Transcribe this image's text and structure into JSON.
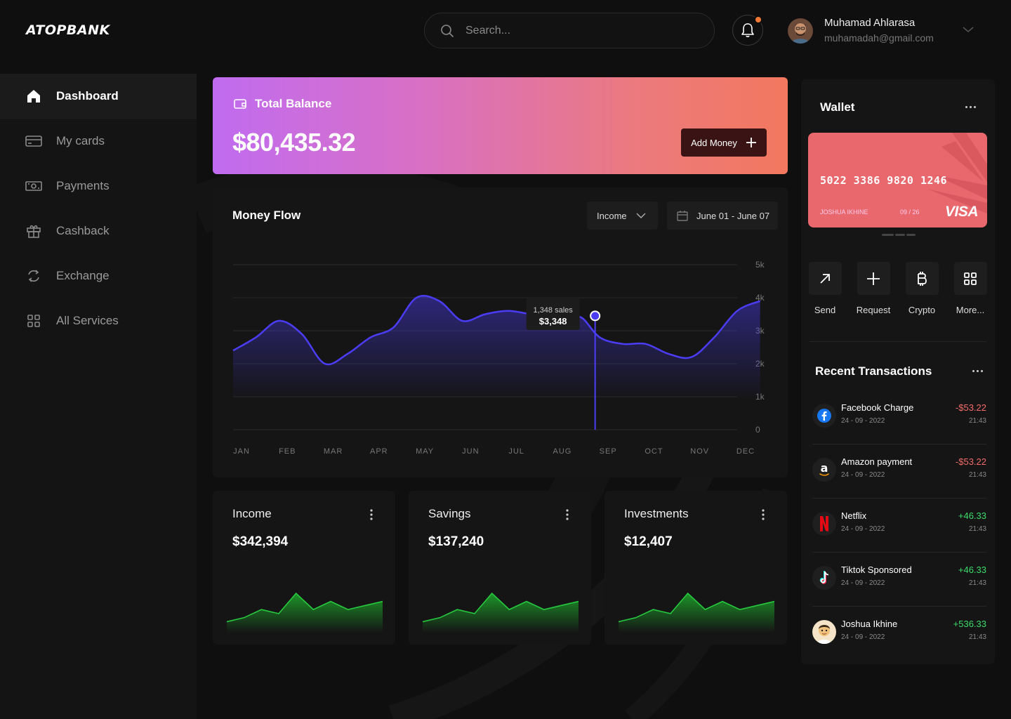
{
  "app": {
    "logo": "ATOPBANK"
  },
  "header": {
    "search_placeholder": "Search...",
    "user_name": "Muhamad Ahlarasa",
    "user_email": "muhamadah@gmail.com",
    "notification_dot_color": "#f07a34"
  },
  "sidebar": {
    "items": [
      {
        "label": "Dashboard",
        "icon": "home-icon"
      },
      {
        "label": "My cards",
        "icon": "card-icon"
      },
      {
        "label": "Payments",
        "icon": "banknote-icon"
      },
      {
        "label": "Cashback",
        "icon": "gift-icon"
      },
      {
        "label": "Exchange",
        "icon": "exchange-icon"
      },
      {
        "label": "All Services",
        "icon": "grid-icon"
      }
    ]
  },
  "balance": {
    "label": "Total Balance",
    "amount": "$80,435.32",
    "add_money_label": "Add Money"
  },
  "money_flow": {
    "title": "Money Flow",
    "filter_selected": "Income",
    "date_range": "June 01 - June 07",
    "tooltip_sales": "1,348 sales",
    "tooltip_value": "$3,348"
  },
  "chart_data": {
    "type": "line",
    "categories": [
      "JAN",
      "FEB",
      "MAR",
      "APR",
      "MAY",
      "JUN",
      "JUL",
      "AUG",
      "SEP",
      "OCT",
      "NOV",
      "DEC"
    ],
    "x": [
      0,
      0.5,
      1,
      1.5,
      2,
      2.5,
      3,
      3.5,
      4,
      4.5,
      5,
      5.5,
      6,
      6.5,
      7,
      7.3,
      7.6,
      8,
      8.5,
      9,
      9.5,
      10,
      10.5,
      11,
      11.5
    ],
    "y": [
      2.4,
      2.8,
      3.3,
      2.9,
      2.0,
      2.3,
      2.8,
      3.1,
      4.0,
      3.9,
      3.3,
      3.5,
      3.6,
      3.5,
      3.4,
      3.3,
      3.4,
      2.8,
      2.6,
      2.6,
      2.3,
      2.2,
      2.8,
      3.6,
      3.9
    ],
    "yticks": [
      "0",
      "1k",
      "2k",
      "3k",
      "4k",
      "5k"
    ],
    "ylim": [
      0,
      5
    ],
    "highlight_x": 7.9,
    "highlight_y": 3.45,
    "line_color": "#4b3cf5",
    "grid": true
  },
  "stats": [
    {
      "title": "Income",
      "value": "$342,394",
      "spark": [
        2,
        3,
        5,
        4,
        9,
        5,
        7,
        5,
        6,
        7
      ]
    },
    {
      "title": "Savings",
      "value": "$137,240",
      "spark": [
        2,
        3,
        5,
        4,
        9,
        5,
        7,
        5,
        6,
        7
      ]
    },
    {
      "title": "Investments",
      "value": "$12,407",
      "spark": [
        2,
        3,
        5,
        4,
        9,
        5,
        7,
        5,
        6,
        7
      ]
    }
  ],
  "wallet": {
    "title": "Wallet",
    "card_number": "5022 3386 9820 1246",
    "card_holder": "JOSHUA IKHINE",
    "card_expiry": "09 / 26",
    "card_brand": "VISA",
    "card_color": "#e8686d",
    "actions": [
      {
        "label": "Send",
        "icon": "arrow-up-right-icon"
      },
      {
        "label": "Request",
        "icon": "plus-icon"
      },
      {
        "label": "Crypto",
        "icon": "bitcoin-icon"
      },
      {
        "label": "More...",
        "icon": "grid-icon"
      }
    ]
  },
  "transactions": {
    "title": "Recent Transactions",
    "items": [
      {
        "name": "Facebook Charge",
        "date": "24 - 09 - 2022",
        "amount": "-$53.22",
        "time": "21:43",
        "icon": "facebook-icon",
        "direction": "neg"
      },
      {
        "name": "Amazon payment",
        "date": "24 - 09 - 2022",
        "amount": "-$53.22",
        "time": "21:43",
        "icon": "amazon-icon",
        "direction": "neg"
      },
      {
        "name": "Netflix",
        "date": "24 - 09 - 2022",
        "amount": "+46.33",
        "time": "21:43",
        "icon": "netflix-icon",
        "direction": "pos"
      },
      {
        "name": "Tiktok Sponsored",
        "date": "24 - 09 - 2022",
        "amount": "+46.33",
        "time": "21:43",
        "icon": "tiktok-icon",
        "direction": "pos"
      },
      {
        "name": "Joshua Ikhine",
        "date": "24 - 09 - 2022",
        "amount": "+536.33",
        "time": "21:43",
        "icon": "avatar",
        "direction": "pos"
      }
    ]
  }
}
